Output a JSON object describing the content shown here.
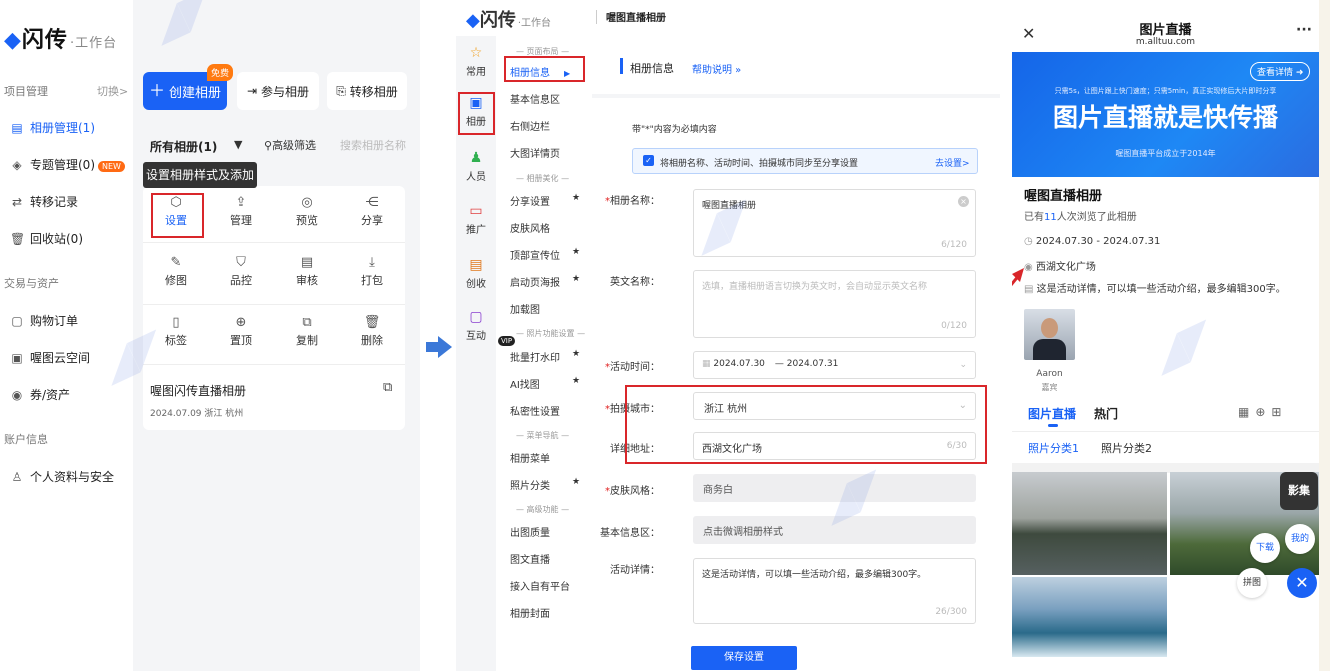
{
  "panel1": {
    "logo": "闪传",
    "logo_sub": "·工作台",
    "section_project": "项目管理",
    "switch": "切换>",
    "nav": [
      {
        "label": "相册管理(1)",
        "icon": "album-icon"
      },
      {
        "label": "专题管理(0)",
        "icon": "topic-icon"
      },
      {
        "label": "转移记录",
        "icon": "transfer-icon"
      },
      {
        "label": "回收站(0)",
        "icon": "trash-icon"
      }
    ],
    "new_badge": "NEW",
    "section_trade": "交易与资产",
    "nav2": [
      {
        "label": "购物订单",
        "icon": "order-icon"
      },
      {
        "label": "喔图云空间",
        "icon": "cloud-icon"
      },
      {
        "label": "券/资产",
        "icon": "coupon-icon"
      }
    ],
    "section_account": "账户信息",
    "nav3": [
      {
        "label": "个人资料与安全",
        "icon": "user-icon"
      }
    ],
    "create_btn": "创建相册",
    "free_badge": "免费",
    "join_btn": "参与相册",
    "transfer_btn": "转移相册",
    "filter_all": "所有相册(1)",
    "filter_adv": "高级筛选",
    "search_placeholder": "搜索相册名称",
    "tooltip": "设置相册样式及添加人员",
    "actions": [
      "设置",
      "管理",
      "预览",
      "分享",
      "修图",
      "品控",
      "审核",
      "打包",
      "标签",
      "置顶",
      "复制",
      "删除"
    ],
    "album_name": "喔图闪传直播相册",
    "album_meta": "2024.07.09 浙江 杭州"
  },
  "panel2": {
    "logo": "闪传",
    "logo_sub": "·工作台",
    "page_title": "喔图直播相册",
    "icon_nav": [
      {
        "label": "常用",
        "icon": "star-icon"
      },
      {
        "label": "相册",
        "icon": "album-icon"
      },
      {
        "label": "人员",
        "icon": "people-icon"
      },
      {
        "label": "推广",
        "icon": "promo-icon"
      },
      {
        "label": "创收",
        "icon": "revenue-icon"
      },
      {
        "label": "互动",
        "icon": "chat-icon"
      }
    ],
    "menu_head1": "— 页面布局 —",
    "menu_active": "相册信息",
    "menu1": [
      "基本信息区",
      "右侧边栏",
      "大图详情页"
    ],
    "menu_head2": "— 相册美化 —",
    "menu2": [
      "分享设置",
      "皮肤风格",
      "顶部宣传位",
      "启动页海报",
      "加载图"
    ],
    "menu_head3": "— 照片功能设置 —",
    "vip": "VIP",
    "menu3": [
      "批量打水印",
      "AI找图",
      "私密性设置"
    ],
    "menu_head4": "— 菜单导航 —",
    "menu4": [
      "相册菜单",
      "照片分类"
    ],
    "menu_head5": "— 高级功能 —",
    "menu5": [
      "出图质量",
      "图文直播",
      "接入自有平台",
      "相册封面"
    ],
    "form_title": "相册信息",
    "help": "帮助说明 »",
    "req_note": "带\"*\"内容为必填内容",
    "sync_text": "将相册名称、活动时间、拍摄城市同步至分享设置",
    "sync_link": "去设置>",
    "label_name": "相册名称：",
    "value_name": "喔图直播相册",
    "count_name": "6/120",
    "label_en": "英文名称：",
    "placeholder_en": "选填，直播相册语言切换为英文时，会自动显示英文名称",
    "count_en": "0/120",
    "label_time": "活动时间：",
    "time_start": "2024.07.30",
    "time_end": "— 2024.07.31",
    "label_city": "拍摄城市：",
    "value_city": "浙江 杭州",
    "label_addr": "详细地址：",
    "value_addr": "西湖文化广场",
    "count_addr": "6/30",
    "label_skin": "皮肤风格：",
    "value_skin": "商务白",
    "label_basic": "基本信息区：",
    "value_basic": "点击微调相册样式",
    "label_detail": "活动详情：",
    "value_detail": "这是活动详情，可以填一些活动介绍，最多编辑300字。",
    "count_detail": "26/300",
    "save_btn": "保存设置"
  },
  "panel3": {
    "title": "图片直播",
    "domain": "m.alltuu.com",
    "banner_btn": "查看详情",
    "banner_small": "只需5s，让图片跟上快门速度；只需5min，真正实现修后大片即时分享",
    "banner_big": "图片直播就是快传播",
    "banner_foot": "喔图直播平台成立于2014年",
    "album_title": "喔图直播相册",
    "views_pre": "已有",
    "views_num": "11",
    "views_post": "人次浏览了此相册",
    "date": "2024.07.30 - 2024.07.31",
    "location": "西湖文化广场",
    "detail": "这是活动详情，可以填一些活动介绍，最多编辑300字。",
    "guest_name": "Aaron",
    "guest_role": "嘉宾",
    "tab_live": "图片直播",
    "tab_hot": "热门",
    "cat1": "照片分类1",
    "cat2": "照片分类2",
    "float_collect": "影集",
    "float_mine": "我的",
    "float_download": "下载",
    "float_puzzle": "拼图"
  },
  "colors": {
    "accent": "#1a62f5",
    "highlight": "#d9262a",
    "orange": "#ff6a13"
  }
}
